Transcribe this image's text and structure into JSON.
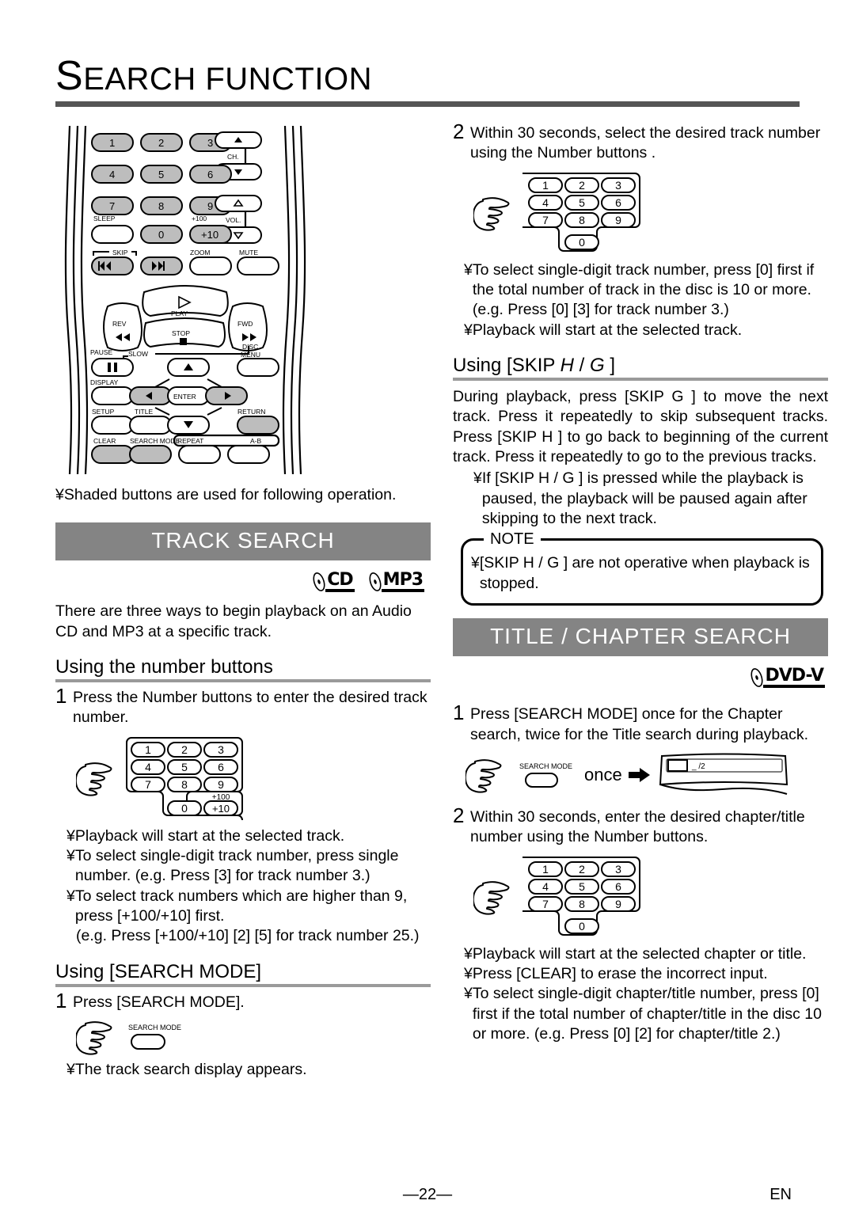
{
  "header": {
    "title_cap": "S",
    "title_rest": "EARCH FUNCTION"
  },
  "remote": {
    "caption_bullet": "¥",
    "caption": "Shaded buttons are used for following operation.",
    "buttons": {
      "n1": "1",
      "n2": "2",
      "n3": "3",
      "n4": "4",
      "n5": "5",
      "n6": "6",
      "n7": "7",
      "n8": "8",
      "n9": "9",
      "n0": "0",
      "plus10": "+10",
      "plus100": "+100",
      "ch": "CH.",
      "vol": "VOL.",
      "sleep": "SLEEP",
      "skip": "SKIP",
      "zoom": "ZOOM",
      "mute": "MUTE",
      "play": "PLAY",
      "rev": "REV",
      "fwd": "FWD",
      "stop": "STOP",
      "pause": "PAUSE",
      "slow": "SLOW",
      "disc_menu_l1": "DISC",
      "disc_menu_l2": "MENU",
      "display": "DISPLAY",
      "enter": "ENTER",
      "setup": "SETUP",
      "title": "TITLE",
      "return": "RETURN",
      "clear": "CLEAR",
      "search_mode": "SEARCH MODE",
      "repeat": "REPEAT",
      "ab": "A-B"
    }
  },
  "track_search": {
    "banner": "TRACK SEARCH",
    "logos": [
      {
        "name": "cd-logo",
        "label": "CD"
      },
      {
        "name": "mp3-logo",
        "label": "MP3"
      }
    ],
    "intro": "There are three ways to begin playback on an Audio CD and MP3 at a specific track.",
    "using_numbers": {
      "heading": "Using the number buttons",
      "step1_num": "1",
      "step1_text": "Press the Number buttons  to enter the desired track number.",
      "keypad": [
        "1",
        "2",
        "3",
        "4",
        "5",
        "6",
        "7",
        "8",
        "9",
        "0",
        "+10"
      ],
      "keypad_plus100": "+100",
      "bullets": [
        "Playback will start at the selected track.",
        "To select single-digit track number, press single number. (e.g. Press [3] for track number 3.)",
        "To select track numbers which are higher than 9, press [+100/+10] first.",
        "(e.g. Press [+100/+10] [2] [5]  for track number 25.)"
      ]
    },
    "using_search_mode": {
      "heading": "Using [SEARCH MODE]",
      "step1_num": "1",
      "step1_text": "Press [SEARCH MODE].",
      "button_label": "SEARCH MODE",
      "bullets": [
        "The track search display appears."
      ]
    }
  },
  "right_column": {
    "step2_num": "2",
    "step2_text": "Within 30 seconds, select the desired track number using the Number buttons .",
    "keypad": [
      "1",
      "2",
      "3",
      "4",
      "5",
      "6",
      "7",
      "8",
      "9",
      "0"
    ],
    "bullets": [
      "To select single-digit track number, press [0] first if the total number of track in the disc is 10 or more. (e.g. Press [0] [3]  for track number 3.)",
      "Playback will start at the selected track."
    ],
    "using_skip": {
      "heading_pre": "Using [SKIP ",
      "heading_icon_prev": "H",
      "heading_sep": " / ",
      "heading_icon_next": "G",
      "heading_post": " ]",
      "body": "During playback, press [SKIP G ] to move the next track. Press it repeatedly to skip subsequent tracks. Press [SKIP H ] to go back to beginning of the current track. Press it repeatedly to go to the previous tracks.",
      "bullets": [
        "If [SKIP H  / G  ] is pressed while the playback is paused, the playback will be paused again after skipping to the next track."
      ],
      "note_label": "NOTE",
      "note_bullets": [
        "[SKIP H  / G  ] are not operative when playback is stopped."
      ]
    }
  },
  "title_chapter_search": {
    "banner": "TITLE / CHAPTER SEARCH",
    "logos": [
      {
        "name": "dvd-v-logo",
        "label": "DVD-V"
      }
    ],
    "step1_num": "1",
    "step1_text": "Press [SEARCH MODE]  once for the Chapter search, twice for the Title search during playback.",
    "button_label": "SEARCH MODE",
    "once_label": "once",
    "tv_display_text": "_ /2",
    "step2_num": "2",
    "step2_text": "Within 30 seconds, enter the desired chapter/title number using the Number buttons.",
    "keypad": [
      "1",
      "2",
      "3",
      "4",
      "5",
      "6",
      "7",
      "8",
      "9",
      "0"
    ],
    "bullets": [
      "Playback will start at the selected chapter or title.",
      "Press [CLEAR] to erase the incorrect input.",
      "To select single-digit chapter/title number, press [0] first if the total number of chapter/title in the disc 10 or more. (e.g. Press [0] [2]  for chapter/title 2.)"
    ]
  },
  "footer": {
    "page_number": "—22—",
    "language": "EN"
  },
  "colors": {
    "banner_bg": "#848484",
    "rule": "#555555",
    "subrule": "#9a9a9a",
    "shaded_button": "#bdbdbd"
  }
}
